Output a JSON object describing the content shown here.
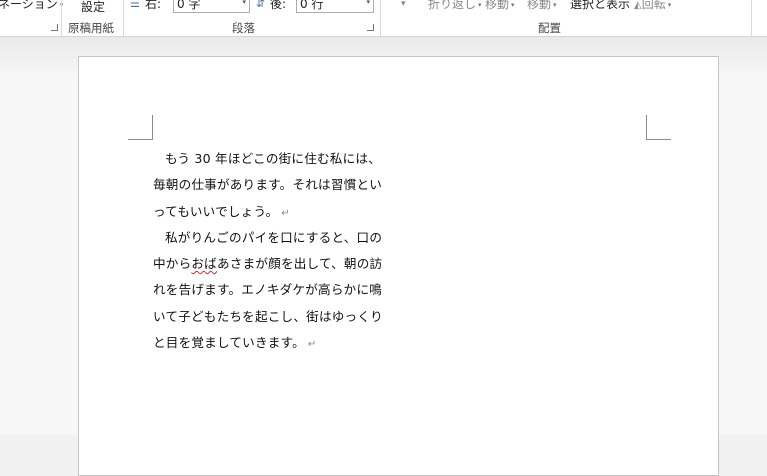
{
  "ribbon": {
    "partial_left_label": "ネーション",
    "setting_label": "設定",
    "genko_group_label": "原稿用紙",
    "indent_right_label": "右:",
    "indent_right_value": "0 字",
    "spacing_after_label": "後:",
    "spacing_after_value": "0 行",
    "paragraph_group_label": "段落",
    "wrap_text_label": "折り返し",
    "bring_forward_label": "移動",
    "send_backward_label": "移動",
    "selection_pane_label": "選択と表示",
    "rotate_label": "回転",
    "arrange_group_label": "配置"
  },
  "document": {
    "lines": [
      "もう 30 年ほどこの街に住む私には、",
      "毎朝の仕事があります。それは習慣とい",
      "ってもいいでしょう。"
    ],
    "p2_line1": "私がりんごのパイを口にすると、口の",
    "p2_line2_pre": "中から",
    "p2_line2_flagged": "おば",
    "p2_line2_post": "あさまが顔を出して、朝の訪",
    "p2_line3": "れを告げます。エノキダケが高らかに鳴",
    "p2_line4": "いて子どもたちを起こし、街はゆっくり",
    "p2_line5": "と目を覚ましていきます。",
    "paragraph_mark": "↵"
  }
}
